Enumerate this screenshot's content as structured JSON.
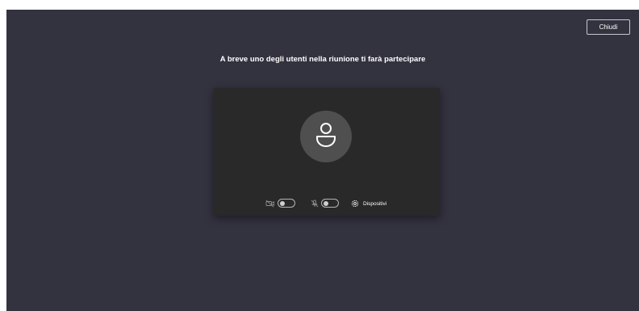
{
  "header": {
    "close_label": "Chiudi"
  },
  "main": {
    "headline": "A breve uno degli utenti nella riunione ti farà partecipare"
  },
  "preview": {
    "avatar_icon": "person-icon",
    "controls": {
      "camera": {
        "icon": "camera-off-icon",
        "state": "off"
      },
      "microphone": {
        "icon": "microphone-off-icon",
        "state": "off"
      },
      "devices": {
        "icon": "gear-icon",
        "label": "Dispositivi"
      }
    }
  },
  "colors": {
    "background": "#33323f",
    "preview_background": "#292929",
    "avatar_background": "#4f4f4f",
    "text": "#ffffff"
  }
}
